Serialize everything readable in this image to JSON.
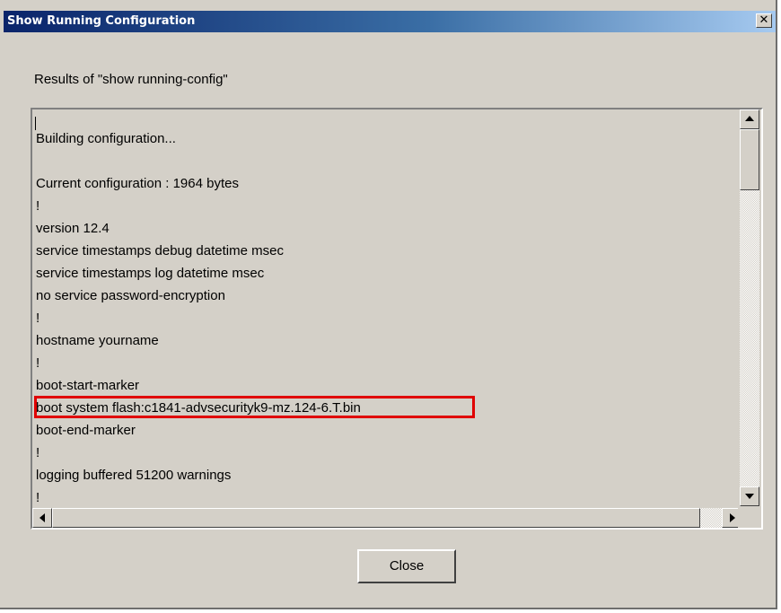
{
  "window": {
    "title": "Show Running Configuration",
    "close_glyph": "✕"
  },
  "results_label": "Results of \"show running-config\"",
  "config_lines": [
    "Building configuration...",
    "",
    "Current configuration : 1964 bytes",
    "!",
    "version 12.4",
    "service timestamps debug datetime msec",
    "service timestamps log datetime msec",
    "no service password-encryption",
    "!",
    "hostname yourname",
    "!",
    "boot-start-marker",
    "boot system flash:c1841-advsecurityk9-mz.124-6.T.bin",
    "boot-end-marker",
    "!",
    "logging buffered 51200 warnings",
    "!"
  ],
  "highlighted_line": "boot system flash:c1841-advsecurityk9-mz.124-6.T.bin",
  "highlight_color": "#e00000",
  "buttons": {
    "close_label": "Close"
  },
  "icons": {
    "scroll_up": "triangle-up-icon",
    "scroll_down": "triangle-down-icon",
    "scroll_left": "triangle-left-icon",
    "scroll_right": "triangle-right-icon"
  }
}
